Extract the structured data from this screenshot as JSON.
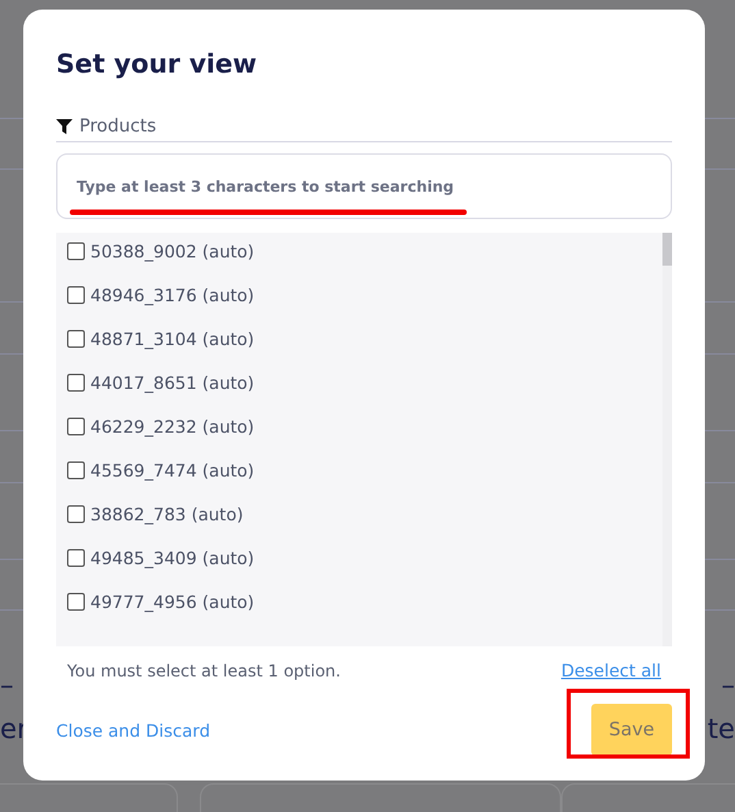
{
  "background": {
    "fragments": [
      {
        "dash": "–",
        "text": "er"
      },
      {
        "dash": "–",
        "text": "te"
      }
    ]
  },
  "dialog": {
    "title": "Set your view",
    "filter": {
      "label": "Products"
    },
    "search": {
      "placeholder": "Type at least 3 characters to start searching",
      "highlighted": true
    },
    "options": [
      {
        "label": "50388_9002 (auto)",
        "checked": false
      },
      {
        "label": "48946_3176 (auto)",
        "checked": false
      },
      {
        "label": "48871_3104 (auto)",
        "checked": false
      },
      {
        "label": "44017_8651 (auto)",
        "checked": false
      },
      {
        "label": "46229_2232 (auto)",
        "checked": false
      },
      {
        "label": "45569_7474 (auto)",
        "checked": false
      },
      {
        "label": "38862_783 (auto)",
        "checked": false
      },
      {
        "label": "49485_3409 (auto)",
        "checked": false
      },
      {
        "label": "49777_4956 (auto)",
        "checked": false
      }
    ],
    "hint": "You must select at least 1 option.",
    "deselect_all": "Deselect all",
    "close": "Close and Discard",
    "save": {
      "label": "Save",
      "disabled": true,
      "highlighted": true
    }
  }
}
